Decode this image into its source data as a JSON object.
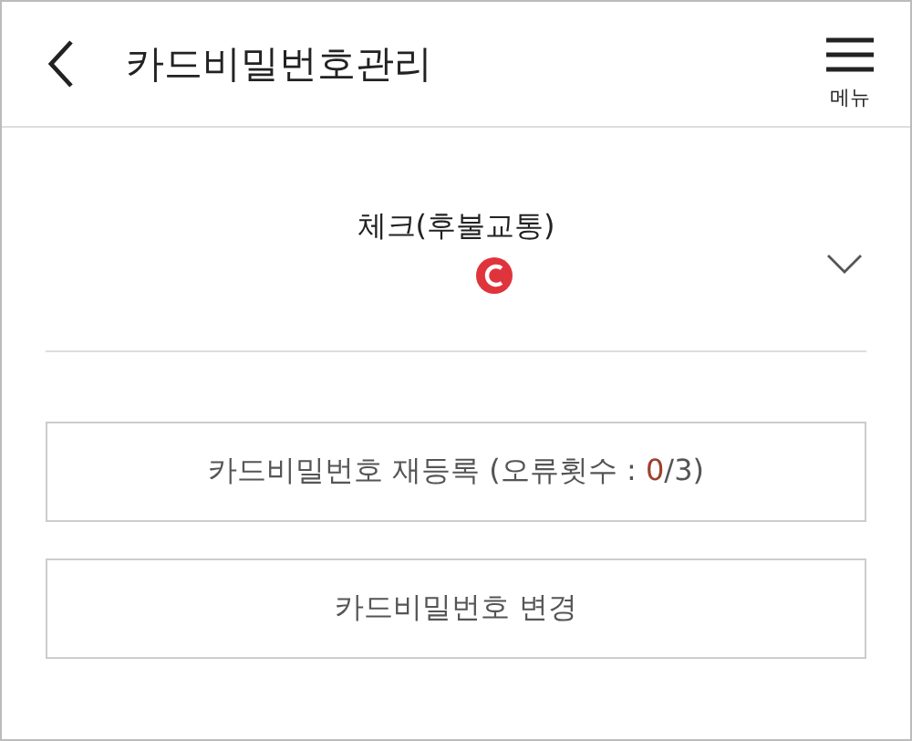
{
  "header": {
    "title": "카드비밀번호관리",
    "menu_label": "메뉴"
  },
  "card_select": {
    "name": "체크(후불교통)"
  },
  "buttons": [
    {
      "kind": "error_count",
      "prefix": "카드비밀번호 재등록 (오류횟수 : ",
      "count": "0",
      "suffix": "/3)"
    },
    {
      "kind": "plain",
      "label": "카드비밀번호 변경"
    }
  ]
}
